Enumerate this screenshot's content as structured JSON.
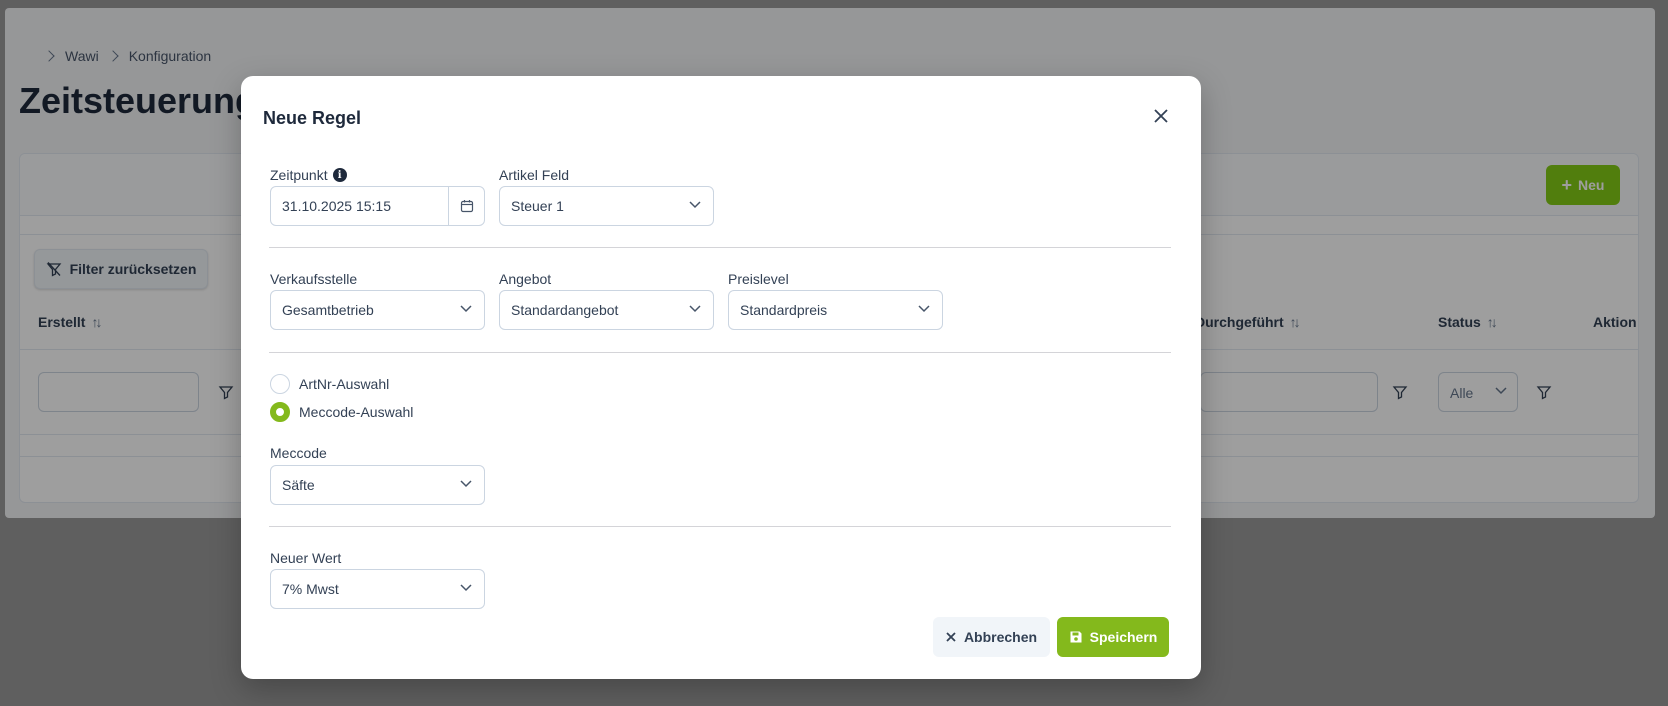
{
  "breadcrumb": {
    "items": [
      "Wawi",
      "Konfiguration"
    ]
  },
  "page": {
    "title": "Zeitsteuerung",
    "new_button": "Neu",
    "filter_reset_button": "Filter zurücksetzen",
    "columns": {
      "created": "Erstellt",
      "executed": "Durchgeführt",
      "status": "Status",
      "action": "Aktion"
    },
    "status_filter_value": "Alle"
  },
  "modal": {
    "title": "Neue Regel",
    "zeitpunkt": {
      "label": "Zeitpunkt",
      "value": "31.10.2025 15:15"
    },
    "artikel_feld": {
      "label": "Artikel Feld",
      "value": "Steuer 1"
    },
    "verkaufsstelle": {
      "label": "Verkaufsstelle",
      "value": "Gesamtbetrieb"
    },
    "angebot": {
      "label": "Angebot",
      "value": "Standardangebot"
    },
    "preislevel": {
      "label": "Preislevel",
      "value": "Standardpreis"
    },
    "radios": {
      "artnr": "ArtNr-Auswahl",
      "meccode": "Meccode-Auswahl",
      "selected": "meccode"
    },
    "meccode": {
      "label": "Meccode",
      "value": "Säfte"
    },
    "neuer_wert": {
      "label": "Neuer Wert",
      "value": "7% Mwst"
    },
    "cancel_button": "Abbrechen",
    "save_button": "Speichern"
  },
  "colors": {
    "accent": "#84b91c",
    "text": "#334155",
    "border": "#cbd5e1"
  },
  "icons": [
    "chevron-right-icon",
    "plus-icon",
    "filter-slash-icon",
    "sort-icon",
    "filter-icon",
    "chevron-down-icon",
    "close-icon",
    "info-icon",
    "calendar-icon",
    "times-icon",
    "save-icon"
  ]
}
